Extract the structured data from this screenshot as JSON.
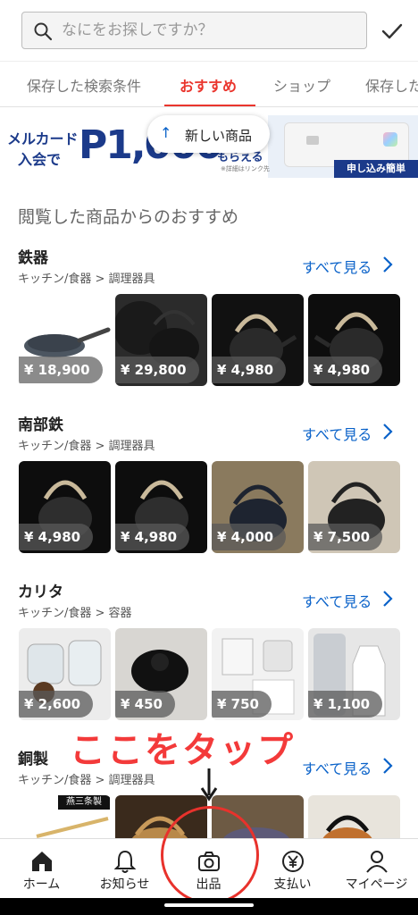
{
  "search": {
    "placeholder": "なにをお探しですか？"
  },
  "tabs": [
    {
      "label": "保存した検索条件"
    },
    {
      "label": "おすすめ"
    },
    {
      "label": "ショップ"
    },
    {
      "label": "保存した"
    }
  ],
  "banner": {
    "line1": "メルカード",
    "line2": "入会で",
    "amount": "P1,000",
    "morae": "もらえる",
    "note": "※詳細はリンク先",
    "apply": "申し込み簡単"
  },
  "new_items_pill": {
    "label": "新しい商品"
  },
  "section_title": "閲覧した商品からのおすすめ",
  "groups": [
    {
      "title": "鉄器",
      "category": "キッチン/食器 > 調理器具",
      "see_all": "すべて見る",
      "prices": [
        "¥ 18,900",
        "¥ 29,800",
        "¥ 4,980",
        "¥ 4,980"
      ]
    },
    {
      "title": "南部鉄",
      "category": "キッチン/食器 > 調理器具",
      "see_all": "すべて見る",
      "prices": [
        "¥ 4,980",
        "¥ 4,980",
        "¥ 4,000",
        "¥ 7,500"
      ]
    },
    {
      "title": "カリタ",
      "category": "キッチン/食器 > 容器",
      "see_all": "すべて見る",
      "prices": [
        "¥ 2,600",
        "¥ 450",
        "¥ 750",
        "¥ 1,100"
      ]
    },
    {
      "title": "銅製",
      "category": "キッチン/食器 > 調理器具",
      "see_all": "すべて見る",
      "prices": []
    }
  ],
  "thumb_badge": "燕三条製",
  "annotation": {
    "text": "ここをタップ"
  },
  "bottom_nav": [
    {
      "label": "ホーム",
      "icon": "home-icon"
    },
    {
      "label": "お知らせ",
      "icon": "bell-icon"
    },
    {
      "label": "出品",
      "icon": "camera-icon"
    },
    {
      "label": "支払い",
      "icon": "yen-icon"
    },
    {
      "label": "マイページ",
      "icon": "person-icon"
    }
  ],
  "colors": {
    "accent": "#ea352d",
    "link": "#0a62c9",
    "annotation": "#f33a3a"
  }
}
